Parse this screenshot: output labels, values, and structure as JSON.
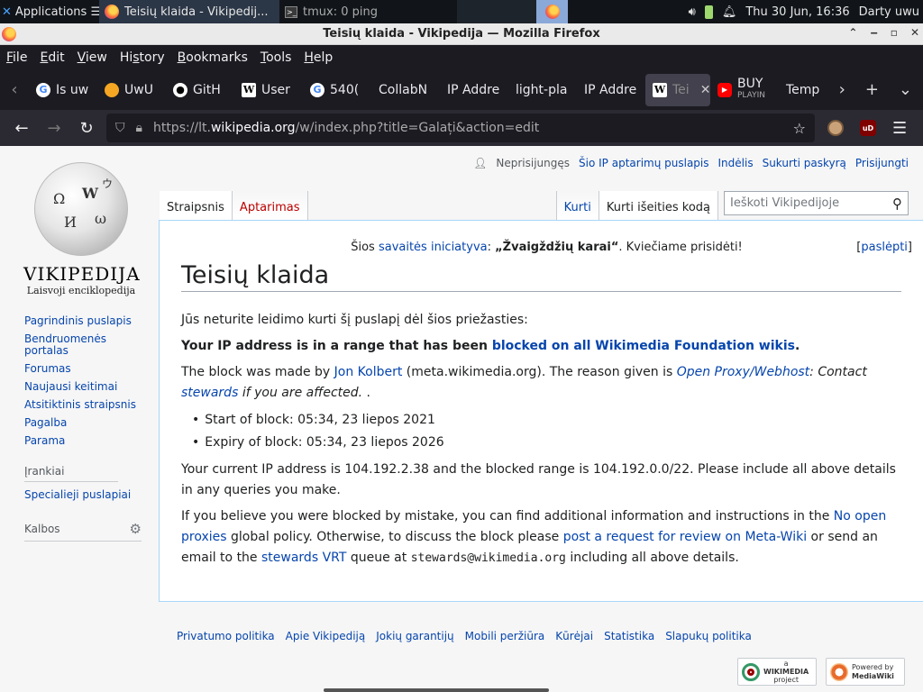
{
  "panel": {
    "apps_label": "Applications ☰",
    "tasks": [
      {
        "label": "Teisių klaida - Vikipedij...",
        "icon": "firefox-icon"
      },
      {
        "label": "tmux: 0 ping",
        "icon": "terminal-icon"
      }
    ],
    "datetime": "Thu 30 Jun, 16:36",
    "user": "Darty uwu"
  },
  "window": {
    "title": "Teisių klaida - Vikipedija — Mozilla Firefox"
  },
  "menubar": {
    "items": [
      {
        "key": "F",
        "rest": "ile"
      },
      {
        "key": "E",
        "rest": "dit"
      },
      {
        "key": "V",
        "rest": "iew"
      },
      {
        "pre": "Hi",
        "key": "s",
        "rest": "tory"
      },
      {
        "key": "B",
        "rest": "ookmarks"
      },
      {
        "key": "T",
        "rest": "ools"
      },
      {
        "key": "H",
        "rest": "elp"
      }
    ]
  },
  "tabs": [
    {
      "label": "Is uw",
      "icon": "google-icon",
      "glyph": "G",
      "cls": "g"
    },
    {
      "label": "UwU",
      "icon": "uwu-icon",
      "glyph": "",
      "cls": "uwu"
    },
    {
      "label": "GitH",
      "icon": "github-icon",
      "glyph": "●",
      "cls": "gh"
    },
    {
      "label": "User",
      "icon": "wikipedia-icon",
      "glyph": "W",
      "cls": "w"
    },
    {
      "label": "540(",
      "icon": "google-icon",
      "glyph": "G",
      "cls": "g"
    },
    {
      "label": "CollabN",
      "icon": "",
      "glyph": "",
      "cls": ""
    },
    {
      "label": "IP Addre",
      "icon": "",
      "glyph": "",
      "cls": ""
    },
    {
      "label": "light-pla",
      "icon": "",
      "glyph": "",
      "cls": ""
    },
    {
      "label": "IP Addre",
      "icon": "",
      "glyph": "",
      "cls": ""
    },
    {
      "label": "Tei",
      "icon": "wikipedia-icon",
      "glyph": "W",
      "cls": "w",
      "active": true
    },
    {
      "label": "BUY",
      "sub": "PLAYIN",
      "icon": "youtube-icon",
      "glyph": "▶",
      "cls": "yt"
    },
    {
      "label": "Temp",
      "icon": "",
      "glyph": "",
      "cls": ""
    }
  ],
  "navbar": {
    "url_prefix": "https://lt.",
    "url_domain": "wikipedia.org",
    "url_path": "/w/index.php?title=Galați&action=edit"
  },
  "wiki": {
    "logo_wordmark": "VIKIPEDIJA",
    "logo_tagline": "Laisvoji enciklopedija",
    "personal": {
      "not_logged": "Neprisijungęs",
      "ip_talk": "Šio IP aptarimų puslapis",
      "contribs": "Indėlis",
      "create": "Sukurti paskyrą",
      "login": "Prisijungti"
    },
    "tabs": {
      "article": "Straipsnis",
      "talk": "Aptarimas",
      "edit": "Kurti",
      "view_source": "Kurti išeities kodą"
    },
    "search_placeholder": "Ieškoti Vikipedijoje",
    "sidebar": {
      "nav": [
        "Pagrindinis puslapis",
        "Bendruomenės portalas",
        "Forumas",
        "Naujausi keitimai",
        "Atsitiktinis straipsnis",
        "Pagalba",
        "Parama"
      ],
      "tools_header": "Įrankiai",
      "tools": [
        "Specialieji puslapiai"
      ],
      "languages_header": "Kalbos"
    },
    "sitenotice": {
      "pre": "Šios ",
      "link": "savaitės iniciatyva",
      "mid": ": ",
      "bold": "„Žvaigždžių karai“",
      "post": ". Kviečiame prisidėti!",
      "hide": "paslėpti"
    },
    "heading": "Teisių klaida",
    "intro": "Jūs neturite leidimo kurti šį puslapį dėl šios priežasties:",
    "blocked_bold": "Your IP address is in a range that has been ",
    "blocked_link": "blocked on all Wikimedia Foundation wikis",
    "blocked_end": ".",
    "block_by_pre": "The block was made by ",
    "block_by_user": "Jon Kolbert",
    "block_by_mid": " (meta.wikimedia.org). The reason given is ",
    "reason_link": "Open Proxy/Webhost",
    "reason_colon": ": Contact ",
    "reason_stewards": "stewards",
    "reason_end": " if you are affected.",
    "reason_tail": " .",
    "start": "Start of block: 05:34, 23 liepos 2021",
    "expiry": "Expiry of block: 05:34, 23 liepos 2026",
    "current_ip": "Your current IP address is 104.192.2.38 and the blocked range is 104.192.0.0/22. Please include all above details in any queries you make.",
    "mistake_pre": "If you believe you were blocked by mistake, you can find additional information and instructions in the ",
    "mistake_link": "No open proxies",
    "mistake_mid": " global policy. Otherwise, to discuss the block please ",
    "mistake_link2": "post a request for review on Meta-Wiki",
    "mistake_mid2": " or send an email to the ",
    "mistake_link3": "stewards VRT",
    "mistake_mid3": " queue at ",
    "mistake_email": "stewards@wikimedia.org",
    "mistake_end": " including all above details.",
    "footer": [
      "Privatumo politika",
      "Apie Vikipediją",
      "Jokių garantijų",
      "Mobili peržiūra",
      "Kūrėjai",
      "Statistika",
      "Slapukų politika"
    ],
    "badge_wikimedia": "WIKIMEDIA",
    "badge_wikimedia_small": "a",
    "badge_wikimedia_sub": "project",
    "badge_mediawiki_top": "Powered by",
    "badge_mediawiki": "MediaWiki"
  }
}
